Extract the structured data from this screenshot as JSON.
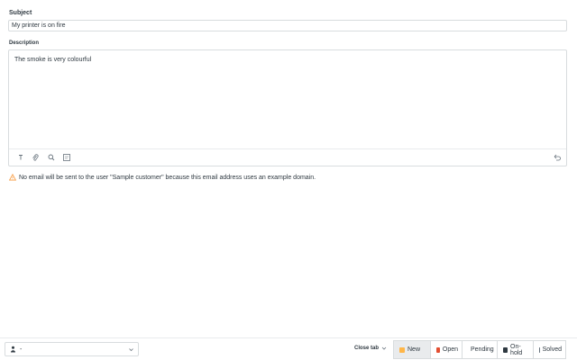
{
  "form": {
    "subject_label": "Subject",
    "subject_value": "My printer is on fire",
    "description_label": "Description",
    "description_value": "The smoke is very colourful"
  },
  "toolbar": {
    "icons": [
      "text-format-icon",
      "attachment-icon",
      "search-icon",
      "template-icon",
      "undo-icon"
    ]
  },
  "warning": {
    "text": "No email will be sent to the user \"Sample customer\" because this email address uses an example domain.",
    "color": "#f79a3e"
  },
  "footer": {
    "assignee_value": "-",
    "close_tab_label": "Close tab",
    "statuses": [
      {
        "label": "New",
        "color": "#ffb648",
        "active": true
      },
      {
        "label": "Open",
        "color": "#e34f32",
        "active": false
      },
      {
        "label": "Pending",
        "color": "#3091ec",
        "active": false
      },
      {
        "label": "On-hold",
        "color": "#2f3941",
        "active": false
      },
      {
        "label": "Solved",
        "color": "#68737d",
        "active": false
      }
    ]
  }
}
